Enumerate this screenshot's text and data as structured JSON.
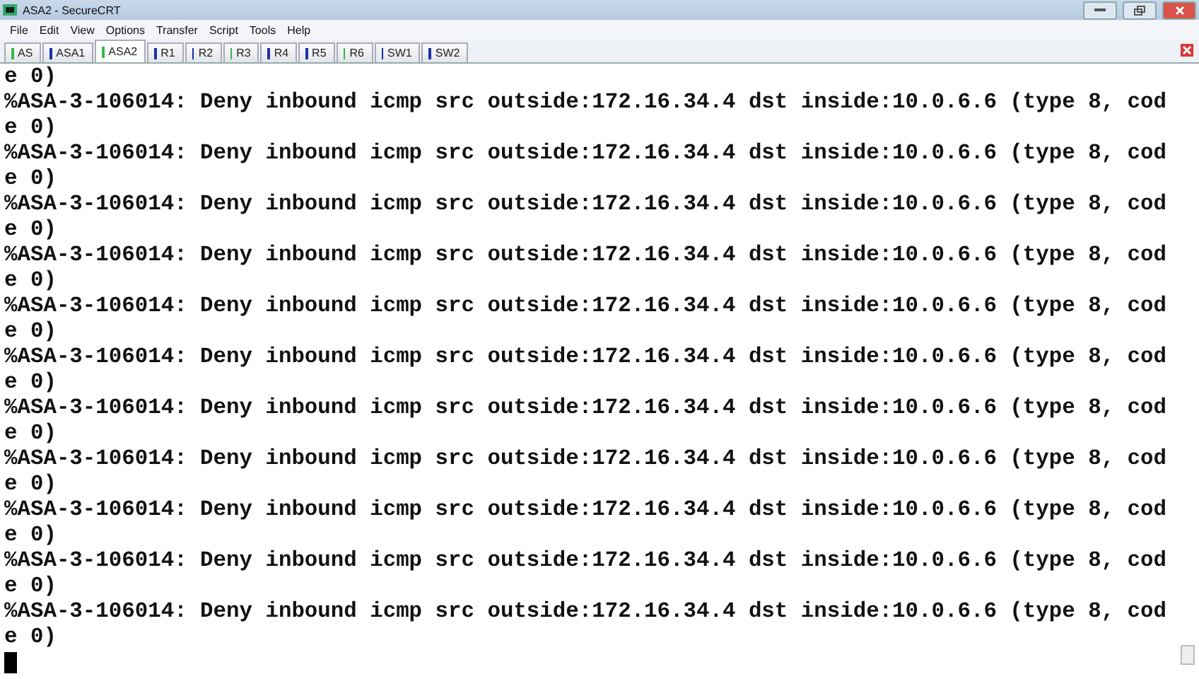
{
  "window": {
    "title": "ASA2 - SecureCRT"
  },
  "menu": [
    "File",
    "Edit",
    "View",
    "Options",
    "Transfer",
    "Script",
    "Tools",
    "Help"
  ],
  "tabs": [
    {
      "label": "AS",
      "selected": false,
      "connected": true
    },
    {
      "label": "ASA1",
      "selected": false,
      "connected": false
    },
    {
      "label": "ASA2",
      "selected": true,
      "connected": true
    },
    {
      "label": "R1",
      "selected": false,
      "connected": false
    },
    {
      "label": "R2",
      "selected": false,
      "connected": false
    },
    {
      "label": "R3",
      "selected": false,
      "connected": true
    },
    {
      "label": "R4",
      "selected": false,
      "connected": false
    },
    {
      "label": "R5",
      "selected": false,
      "connected": false
    },
    {
      "label": "R6",
      "selected": false,
      "connected": true
    },
    {
      "label": "SW1",
      "selected": false,
      "connected": false
    },
    {
      "label": "SW2",
      "selected": false,
      "connected": false
    }
  ],
  "terminal": {
    "lines": [
      "e 0)",
      "%ASA-3-106014: Deny inbound icmp src outside:172.16.34.4 dst inside:10.0.6.6 (type 8, cod",
      "e 0)",
      "%ASA-3-106014: Deny inbound icmp src outside:172.16.34.4 dst inside:10.0.6.6 (type 8, cod",
      "e 0)",
      "%ASA-3-106014: Deny inbound icmp src outside:172.16.34.4 dst inside:10.0.6.6 (type 8, cod",
      "e 0)",
      "%ASA-3-106014: Deny inbound icmp src outside:172.16.34.4 dst inside:10.0.6.6 (type 8, cod",
      "e 0)",
      "%ASA-3-106014: Deny inbound icmp src outside:172.16.34.4 dst inside:10.0.6.6 (type 8, cod",
      "e 0)",
      "%ASA-3-106014: Deny inbound icmp src outside:172.16.34.4 dst inside:10.0.6.6 (type 8, cod",
      "e 0)",
      "%ASA-3-106014: Deny inbound icmp src outside:172.16.34.4 dst inside:10.0.6.6 (type 8, cod",
      "e 0)",
      "%ASA-3-106014: Deny inbound icmp src outside:172.16.34.4 dst inside:10.0.6.6 (type 8, cod",
      "e 0)",
      "%ASA-3-106014: Deny inbound icmp src outside:172.16.34.4 dst inside:10.0.6.6 (type 8, cod",
      "e 0)",
      "%ASA-3-106014: Deny inbound icmp src outside:172.16.34.4 dst inside:10.0.6.6 (type 8, cod",
      "e 0)",
      "%ASA-3-106014: Deny inbound icmp src outside:172.16.34.4 dst inside:10.0.6.6 (type 8, cod",
      "e 0)"
    ]
  }
}
